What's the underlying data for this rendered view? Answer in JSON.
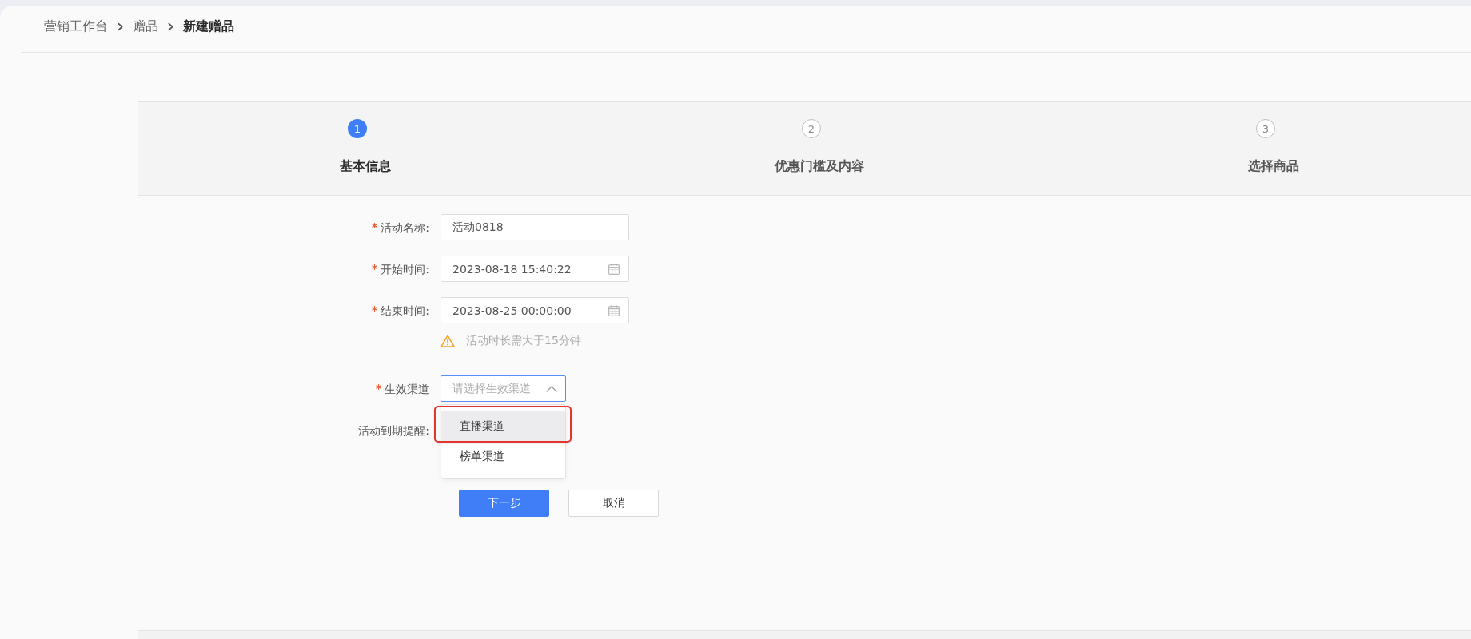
{
  "breadcrumb": [
    {
      "label": "营销工作台",
      "current": false
    },
    {
      "label": "赠品",
      "current": false
    },
    {
      "label": "新建赠品",
      "current": true
    }
  ],
  "steps": [
    {
      "number": "1",
      "label": "基本信息",
      "selected": true
    },
    {
      "number": "2",
      "label": "优惠门槛及内容",
      "selected": false
    },
    {
      "number": "3",
      "label": "选择商品",
      "selected": false
    }
  ],
  "form": {
    "fields": [
      {
        "kind": "text",
        "label": "活动名称:",
        "required": true,
        "value": "活动0818"
      },
      {
        "kind": "datetime",
        "label": "开始时间:",
        "required": true,
        "value": "2023-08-18 15:40:22"
      },
      {
        "kind": "datetime",
        "label": "结束时间:",
        "required": true,
        "value": "2023-08-25 00:00:00",
        "warning": "活动时长需大于15分钟"
      },
      {
        "kind": "select",
        "label": "生效渠道",
        "required": true,
        "placeholder": "请选择生效渠道",
        "expanded": true,
        "options": [
          {
            "label": "直播渠道",
            "hovered": true,
            "annotated": true
          },
          {
            "label": "榜单渠道",
            "hovered": false,
            "annotated": false
          }
        ]
      },
      {
        "kind": "covered",
        "label": "活动到期提醒:",
        "required": false
      }
    ],
    "buttons": [
      {
        "label": "下一步",
        "kind": "primary"
      },
      {
        "label": "取消",
        "kind": "default"
      }
    ]
  }
}
